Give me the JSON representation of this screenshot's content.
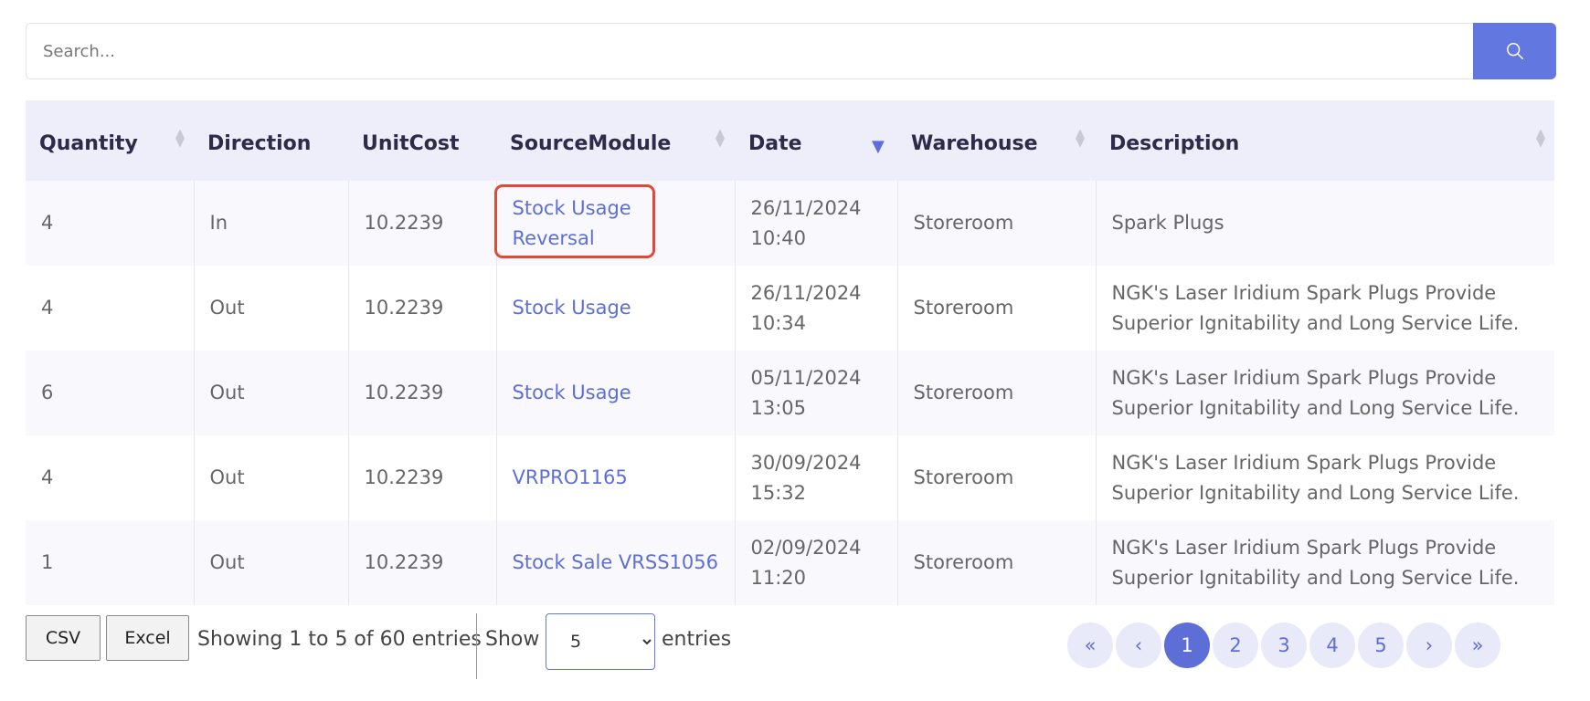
{
  "search": {
    "placeholder": "Search...",
    "icon": "search-icon"
  },
  "table": {
    "columns": [
      "Quantity",
      "Direction",
      "UnitCost",
      "SourceModule",
      "Date",
      "Warehouse",
      "Description"
    ],
    "rows": [
      {
        "quantity": "4",
        "direction": "In",
        "unit_cost": "10.2239",
        "source_module": "Stock Usage Reversal",
        "date": "26/11/2024",
        "time": "10:40",
        "warehouse": "Storeroom",
        "description": "Spark Plugs"
      },
      {
        "quantity": "4",
        "direction": "Out",
        "unit_cost": "10.2239",
        "source_module": "Stock Usage",
        "date": "26/11/2024",
        "time": "10:34",
        "warehouse": "Storeroom",
        "description": "NGK's Laser Iridium Spark Plugs Provide Superior Ignitability and Long Service Life."
      },
      {
        "quantity": "6",
        "direction": "Out",
        "unit_cost": "10.2239",
        "source_module": "Stock Usage",
        "date": "05/11/2024",
        "time": "13:05",
        "warehouse": "Storeroom",
        "description": "NGK's Laser Iridium Spark Plugs Provide Superior Ignitability and Long Service Life."
      },
      {
        "quantity": "4",
        "direction": "Out",
        "unit_cost": "10.2239",
        "source_module": "VRPRO1165",
        "date": "30/09/2024",
        "time": "15:32",
        "warehouse": "Storeroom",
        "description": "NGK's Laser Iridium Spark Plugs Provide Superior Ignitability and Long Service Life."
      },
      {
        "quantity": "1",
        "direction": "Out",
        "unit_cost": "10.2239",
        "source_module": "Stock Sale VRSS1056",
        "date": "02/09/2024",
        "time": "11:20",
        "warehouse": "Storeroom",
        "description": "NGK's Laser Iridium Spark Plugs Provide Superior Ignitability and Long Service Life."
      }
    ]
  },
  "footer": {
    "csv_label": "CSV",
    "excel_label": "Excel",
    "info": "Showing 1 to 5 of 60 entries",
    "show_label": "Show",
    "entries_label": "entries",
    "page_length": "5",
    "page_length_options": [
      "5"
    ]
  },
  "pagination": {
    "first": "«",
    "prev": "‹",
    "pages": [
      "1",
      "2",
      "3",
      "4",
      "5"
    ],
    "active_page": "1",
    "next": "›",
    "last": "»"
  },
  "colors": {
    "accent": "#6277e0",
    "link": "#5d6fd6",
    "highlight": "#dc4a3a",
    "header_bg": "#eeeefa"
  }
}
